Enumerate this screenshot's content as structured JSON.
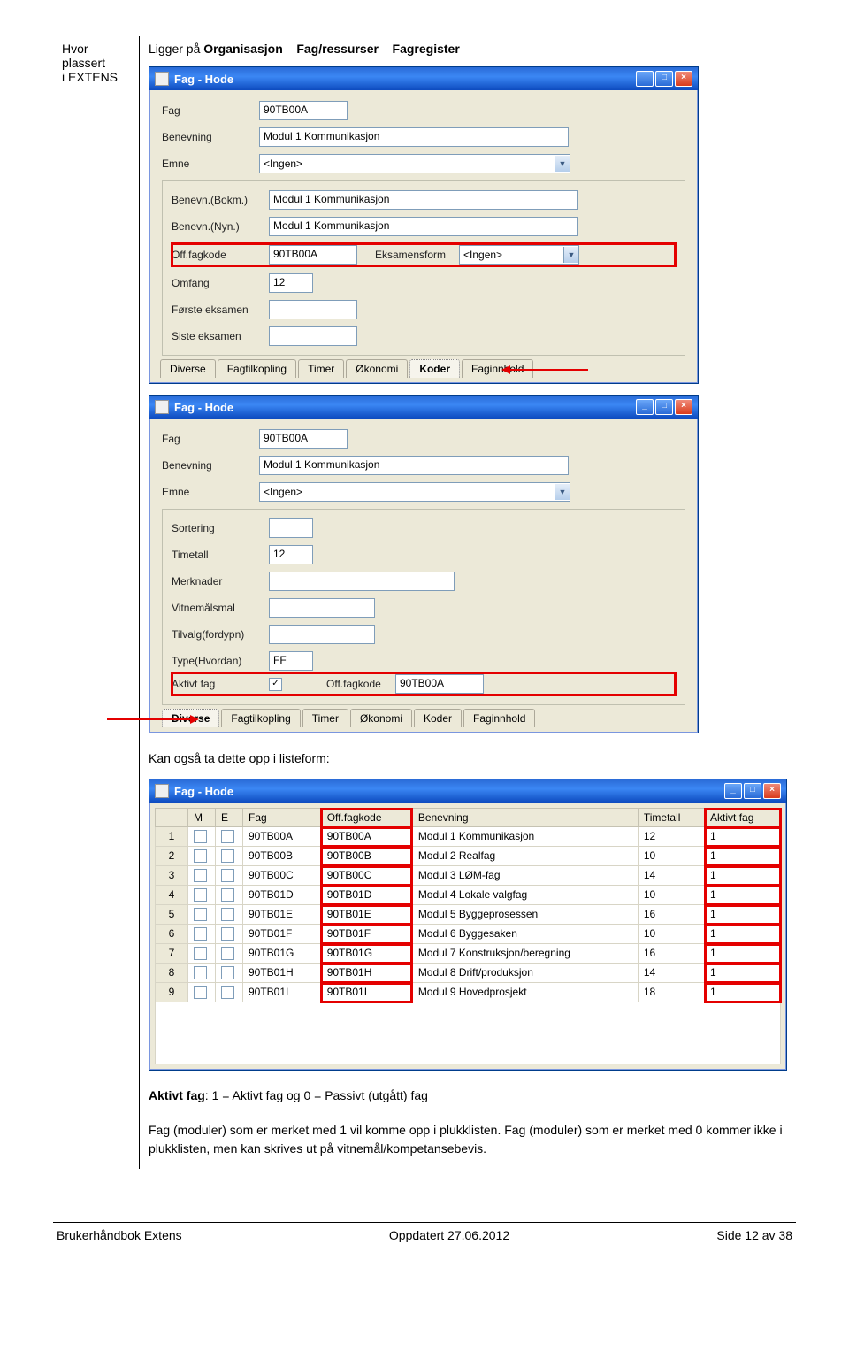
{
  "header": {
    "left_line1": "Hvor plassert",
    "left_line2": "i EXTENS",
    "right_prefix": "Ligger på ",
    "right_path1": "Organisasjon",
    "right_sep": " – ",
    "right_path2": "Fag/ressurser",
    "right_path3": "Fagregister"
  },
  "win1": {
    "title": "Fag - Hode",
    "fag_label": "Fag",
    "fag_value": "90TB00A",
    "benevning_label": "Benevning",
    "benevning_value": "Modul 1 Kommunikasjon",
    "emne_label": "Emne",
    "emne_value": "<Ingen>",
    "bokm_label": "Benevn.(Bokm.)",
    "bokm_value": "Modul 1 Kommunikasjon",
    "nyn_label": "Benevn.(Nyn.)",
    "nyn_value": "Modul 1 Kommunikasjon",
    "off_label": "Off.fagkode",
    "off_value": "90TB00A",
    "eksamensform_label": "Eksamensform",
    "eksamensform_value": "<Ingen>",
    "omfang_label": "Omfang",
    "omfang_value": "12",
    "forste_label": "Første eksamen",
    "siste_label": "Siste eksamen",
    "tabs": [
      "Diverse",
      "Fagtilkopling",
      "Timer",
      "Økonomi",
      "Koder",
      "Faginnhold"
    ],
    "active_tab": "Koder"
  },
  "win2": {
    "title": "Fag - Hode",
    "fag_label": "Fag",
    "fag_value": "90TB00A",
    "benevning_label": "Benevning",
    "benevning_value": "Modul 1 Kommunikasjon",
    "emne_label": "Emne",
    "emne_value": "<Ingen>",
    "sortering_label": "Sortering",
    "timetall_label": "Timetall",
    "timetall_value": "12",
    "merknader_label": "Merknader",
    "vitnemalsmal_label": "Vitnemålsmal",
    "tilvalg_label": "Tilvalg(fordypn)",
    "type_label": "Type(Hvordan)",
    "type_value": "FF",
    "aktivtfag_label": "Aktivt fag",
    "off_label": "Off.fagkode",
    "off_value": "90TB00A",
    "tabs": [
      "Diverse",
      "Fagtilkopling",
      "Timer",
      "Økonomi",
      "Koder",
      "Faginnhold"
    ],
    "active_tab": "Diverse"
  },
  "listeform_text": "Kan også ta dette opp i listeform:",
  "win3": {
    "title": "Fag - Hode",
    "columns": [
      "",
      "M",
      "E",
      "Fag",
      "Off.fagkode",
      "Benevning",
      "Timetall",
      "Aktivt fag"
    ],
    "rows": [
      {
        "n": "1",
        "fag": "90TB00A",
        "off": "90TB00A",
        "ben": "Modul 1 Kommunikasjon",
        "tim": "12",
        "akt": "1"
      },
      {
        "n": "2",
        "fag": "90TB00B",
        "off": "90TB00B",
        "ben": "Modul 2 Realfag",
        "tim": "10",
        "akt": "1"
      },
      {
        "n": "3",
        "fag": "90TB00C",
        "off": "90TB00C",
        "ben": "Modul 3 LØM-fag",
        "tim": "14",
        "akt": "1"
      },
      {
        "n": "4",
        "fag": "90TB01D",
        "off": "90TB01D",
        "ben": "Modul 4 Lokale valgfag",
        "tim": "10",
        "akt": "1"
      },
      {
        "n": "5",
        "fag": "90TB01E",
        "off": "90TB01E",
        "ben": "Modul 5 Byggeprosessen",
        "tim": "16",
        "akt": "1"
      },
      {
        "n": "6",
        "fag": "90TB01F",
        "off": "90TB01F",
        "ben": "Modul 6 Byggesaken",
        "tim": "10",
        "akt": "1"
      },
      {
        "n": "7",
        "fag": "90TB01G",
        "off": "90TB01G",
        "ben": "Modul 7 Konstruksjon/beregning",
        "tim": "16",
        "akt": "1"
      },
      {
        "n": "8",
        "fag": "90TB01H",
        "off": "90TB01H",
        "ben": "Modul 8 Drift/produksjon",
        "tim": "14",
        "akt": "1"
      },
      {
        "n": "9",
        "fag": "90TB01I",
        "off": "90TB01I",
        "ben": "Modul 9 Hovedprosjekt",
        "tim": "18",
        "akt": "1"
      }
    ]
  },
  "para1_prefix": "Aktivt fag",
  "para1_rest": ":  1 = Aktivt fag  og  0 = Passivt (utgått) fag",
  "para2": "Fag (moduler) som er merket med 1 vil komme opp i plukklisten. Fag (moduler) som er merket med 0 kommer ikke i plukklisten, men kan skrives ut på vitnemål/kompetansebevis.",
  "footer": {
    "left": "Brukerhåndbok Extens",
    "center": "Oppdatert  27.06.2012",
    "right": "Side 12  av 38"
  }
}
